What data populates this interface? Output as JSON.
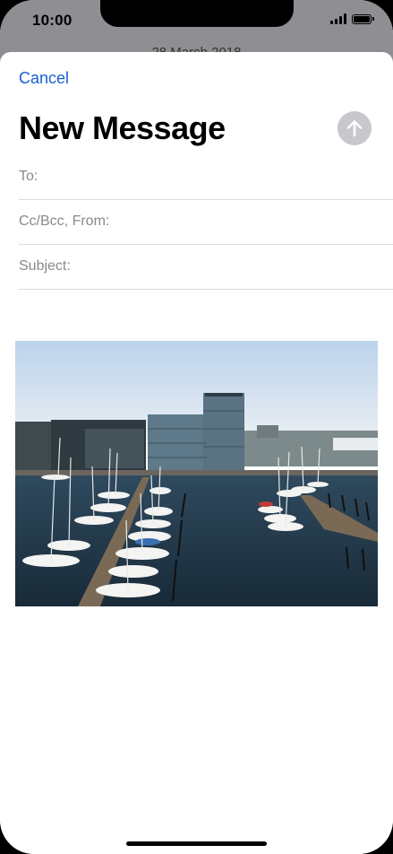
{
  "status_bar": {
    "time": "10:00",
    "signal_icon": "cellular-signal-icon",
    "battery_icon": "battery-icon"
  },
  "background_view": {
    "title_partial": "28 March 2018"
  },
  "compose": {
    "cancel_label": "Cancel",
    "title": "New Message",
    "send_icon": "arrow-up-icon",
    "fields": {
      "to_label": "To:",
      "cc_from_label": "Cc/Bcc, From:",
      "subject_label": "Subject:"
    }
  },
  "attachment": {
    "type": "photo",
    "description_icon": "harbor-photo"
  },
  "colors": {
    "accent": "#1a5fd6",
    "send_disabled": "#c7c7cc",
    "label_gray": "#8a8a8e",
    "divider": "#dcdcdc"
  }
}
